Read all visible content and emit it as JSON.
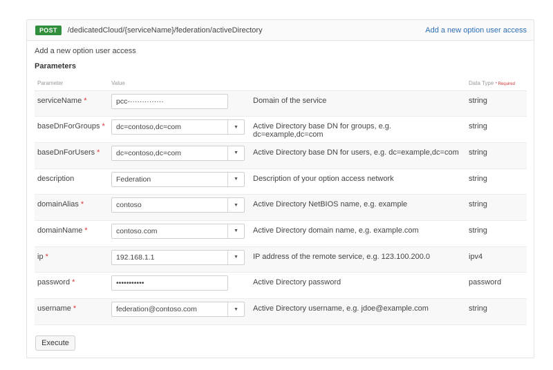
{
  "operation": {
    "method": "POST",
    "path": "/dedicatedCloud/{serviceName}/federation/activeDirectory",
    "summary_link": "Add a new option user access",
    "description": "Add a new option user access"
  },
  "parameters_title": "Parameters",
  "columns": {
    "parameter": "Parameter",
    "value": "Value",
    "description": "",
    "data_type": "Data Type",
    "required_note": "* Required"
  },
  "rows": [
    {
      "name": "serviceName",
      "required": "*",
      "value": "pcc-··············",
      "description": "Domain of the service",
      "type": "string"
    },
    {
      "name": "baseDnForGroups",
      "required": "*",
      "value": "dc=contoso,dc=com",
      "description": "Active Directory base DN for groups, e.g. dc=example,dc=com",
      "type": "string"
    },
    {
      "name": "baseDnForUsers",
      "required": "*",
      "value": "dc=contoso,dc=com",
      "description": "Active Directory base DN for users, e.g. dc=example,dc=com",
      "type": "string"
    },
    {
      "name": "description",
      "required": "",
      "value": "Federation",
      "description": "Description of your option access network",
      "type": "string"
    },
    {
      "name": "domainAlias",
      "required": "*",
      "value": "contoso",
      "description": "Active Directory NetBIOS name, e.g. example",
      "type": "string"
    },
    {
      "name": "domainName",
      "required": "*",
      "value": "contoso.com",
      "description": "Active Directory domain name, e.g. example.com",
      "type": "string"
    },
    {
      "name": "ip",
      "required": "*",
      "value": "192.168.1.1",
      "description": "IP address of the remote service, e.g. 123.100.200.0",
      "type": "ipv4"
    },
    {
      "name": "password",
      "required": "*",
      "value": "•••••••••••",
      "description": "Active Directory password",
      "type": "password"
    },
    {
      "name": "username",
      "required": "*",
      "value": "federation@contoso.com",
      "description": "Active Directory username, e.g. jdoe@example.com",
      "type": "string"
    }
  ],
  "execute_label": "Execute"
}
